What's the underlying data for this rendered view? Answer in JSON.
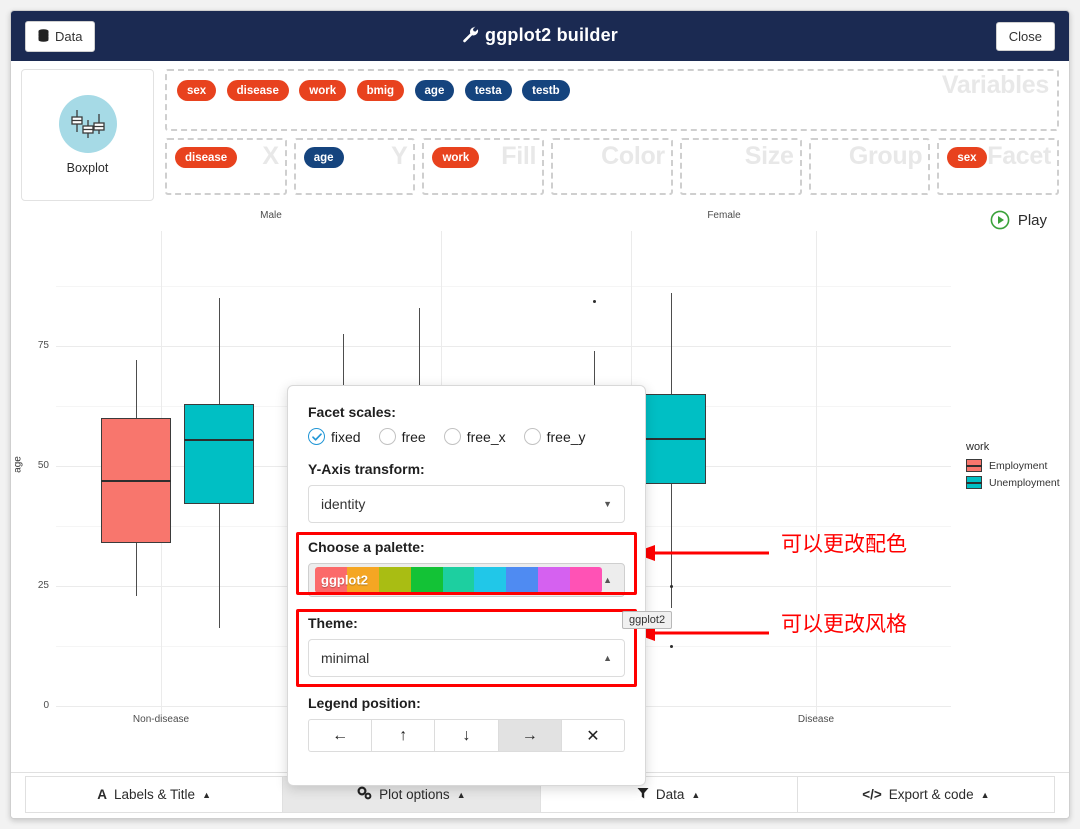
{
  "header": {
    "title": "ggplot2 builder",
    "wrench_icon": "wrench-icon",
    "data_button": "Data",
    "close_button": "Close"
  },
  "geom": {
    "label": "Boxplot",
    "icon": "boxplot-icon"
  },
  "variables": {
    "ghost_label": "Variables",
    "pills": [
      {
        "name": "sex",
        "type": "categorical"
      },
      {
        "name": "disease",
        "type": "categorical"
      },
      {
        "name": "work",
        "type": "categorical"
      },
      {
        "name": "bmig",
        "type": "categorical"
      },
      {
        "name": "age",
        "type": "numeric"
      },
      {
        "name": "testa",
        "type": "numeric"
      },
      {
        "name": "testb",
        "type": "numeric"
      }
    ]
  },
  "aesthetics": [
    {
      "slot": "X",
      "pill": "disease",
      "pill_type": "categorical"
    },
    {
      "slot": "Y",
      "pill": "age",
      "pill_type": "numeric"
    },
    {
      "slot": "Fill",
      "pill": "work",
      "pill_type": "categorical"
    },
    {
      "slot": "Color",
      "pill": null,
      "pill_type": null
    },
    {
      "slot": "Size",
      "pill": null,
      "pill_type": null
    },
    {
      "slot": "Group",
      "pill": null,
      "pill_type": null
    },
    {
      "slot": "Facet",
      "pill": "sex",
      "pill_type": "categorical"
    }
  ],
  "play_button": {
    "label": "Play",
    "icon": "play-circle-icon"
  },
  "chart_data": {
    "type": "boxplot",
    "title": "",
    "xlabel": "",
    "ylabel": "age",
    "ylim": [
      0,
      90
    ],
    "yticks": [
      0,
      25,
      50,
      75
    ],
    "grid": true,
    "legend": {
      "title": "work",
      "position": "right",
      "entries": [
        {
          "label": "Employment",
          "color": "#f8766d"
        },
        {
          "label": "Unemployment",
          "color": "#00bfc4"
        }
      ]
    },
    "facet_var": "sex",
    "facets": [
      {
        "label": "Male",
        "categories": [
          "Non-disease",
          "Disease"
        ],
        "boxes": [
          {
            "category": "Non-disease",
            "fill": "Employment",
            "color": "#f8766d",
            "min": 16,
            "q1": 34,
            "median": 47,
            "q3": 60,
            "max": 72,
            "outliers": []
          },
          {
            "category": "Non-disease",
            "fill": "Unemployment",
            "color": "#00bfc4",
            "min": 14,
            "q1": 44,
            "median": 58,
            "q3": 63,
            "max": 85,
            "outliers": []
          },
          {
            "category": "Disease",
            "fill": "Employment",
            "color": "#f8766d",
            "min": 19,
            "q1": 46,
            "median": 60,
            "q3": 67,
            "max": 78,
            "outliers": []
          },
          {
            "category": "Disease",
            "fill": "Unemployment",
            "color": "#00bfc4",
            "min": 18,
            "q1": 44,
            "median": 56,
            "q3": 68,
            "max": 83,
            "outliers": []
          }
        ]
      },
      {
        "label": "Female",
        "categories": [
          "Non-disease",
          "Disease"
        ],
        "boxes": [
          {
            "category": "Non-disease",
            "fill": "Employment",
            "color": "#f8766d",
            "min": 21,
            "q1": 50,
            "median": 56,
            "q3": 62,
            "max": 72,
            "outliers": [
              79
            ]
          },
          {
            "category": "Non-disease",
            "fill": "Unemployment",
            "color": "#00bfc4",
            "min": 13,
            "q1": 50,
            "median": 57,
            "q3": 64,
            "max": 80,
            "outliers": [
              24,
              13
            ]
          }
        ]
      }
    ],
    "facet_strips": [
      "Male",
      "Female"
    ],
    "xtick_labels": [
      "Non-disease",
      "Disease",
      "Non-disease",
      "Disease"
    ]
  },
  "popover": {
    "facet_scales": {
      "label": "Facet scales:",
      "options": [
        "fixed",
        "free",
        "free_x",
        "free_y"
      ],
      "selected": "fixed"
    },
    "y_transform": {
      "label": "Y-Axis transform:",
      "value": "identity"
    },
    "palette": {
      "label": "Choose a palette:",
      "value": "ggplot2"
    },
    "theme": {
      "label": "Theme:",
      "value": "minimal"
    },
    "legend_position": {
      "label": "Legend position:",
      "options": [
        "left",
        "top",
        "bottom",
        "right",
        "none"
      ],
      "glyphs": [
        "←",
        "↑",
        "↓",
        "→",
        "✕"
      ],
      "selected": "right"
    }
  },
  "tooltip": {
    "text": "ggplot2"
  },
  "annotations": [
    {
      "text": "可以更改配色"
    },
    {
      "text": "可以更改风格"
    }
  ],
  "footer_tabs": [
    {
      "label": "Labels & Title",
      "icon": "font-icon",
      "caret": "▲",
      "active": false
    },
    {
      "label": "Plot options",
      "icon": "gears-icon",
      "caret": "▲",
      "active": true
    },
    {
      "label": "Data",
      "icon": "filter-icon",
      "caret": "▲",
      "active": false
    },
    {
      "label": "Export & code",
      "icon": "code-icon",
      "caret": "▲",
      "active": false
    }
  ],
  "colors": {
    "header_bg": "#1b2a52",
    "pill_categorical": "#e8421e",
    "pill_numeric": "#15447e",
    "employment": "#f8766d",
    "unemployment": "#00bfc4",
    "annotation": "#ff0000"
  }
}
